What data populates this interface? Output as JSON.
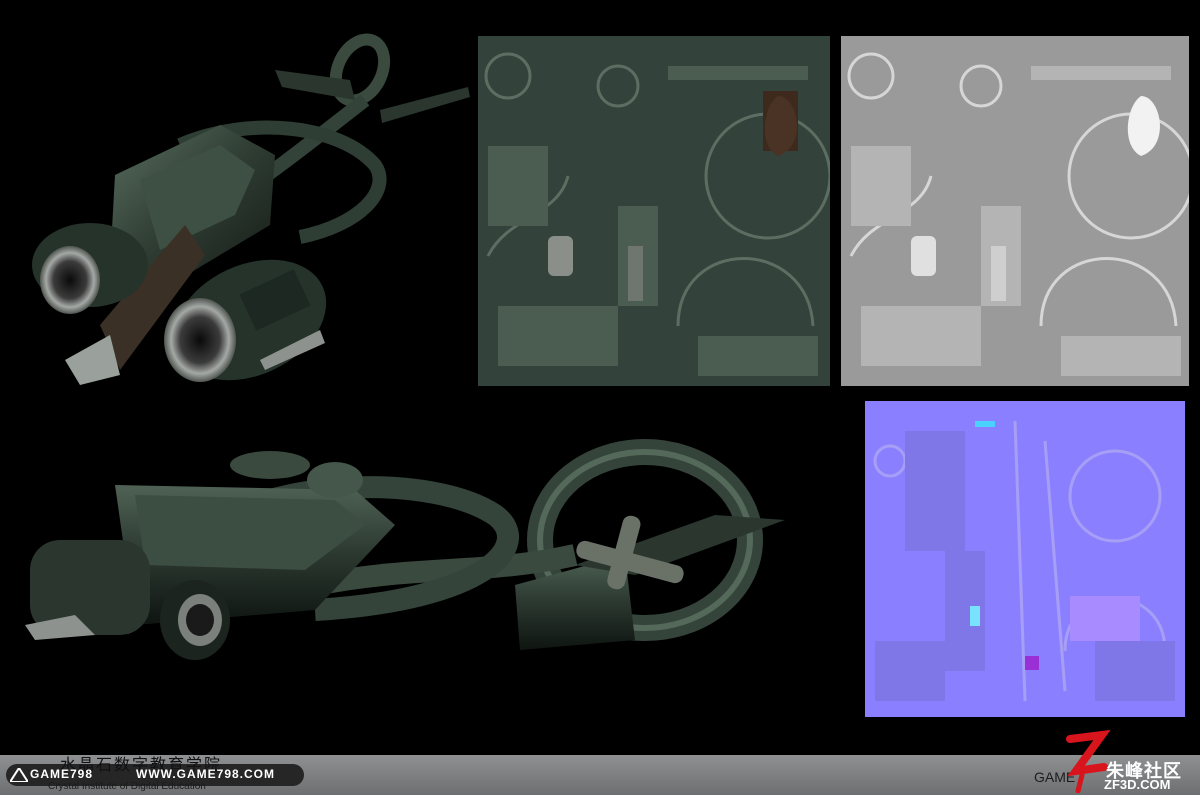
{
  "footer": {
    "chinese_title": "水晶石数字教育学院",
    "game798_label": "GAME798",
    "url": "WWW.GAME798.COM",
    "english_title": "Crystal Institute of Digital Education"
  },
  "watermark": {
    "game_label": "GAME",
    "site_name_cn": "朱峰社区",
    "site_url": "ZF3D.COM"
  },
  "colors": {
    "background": "#000000",
    "hull_green": "#2f3d33",
    "diffuse_texture": "#33423a",
    "specular_texture": "#9a9a9a",
    "normal_map": "#8a80ff",
    "watermark_red": "#d8141c",
    "footer_bar": "#7e8082"
  }
}
